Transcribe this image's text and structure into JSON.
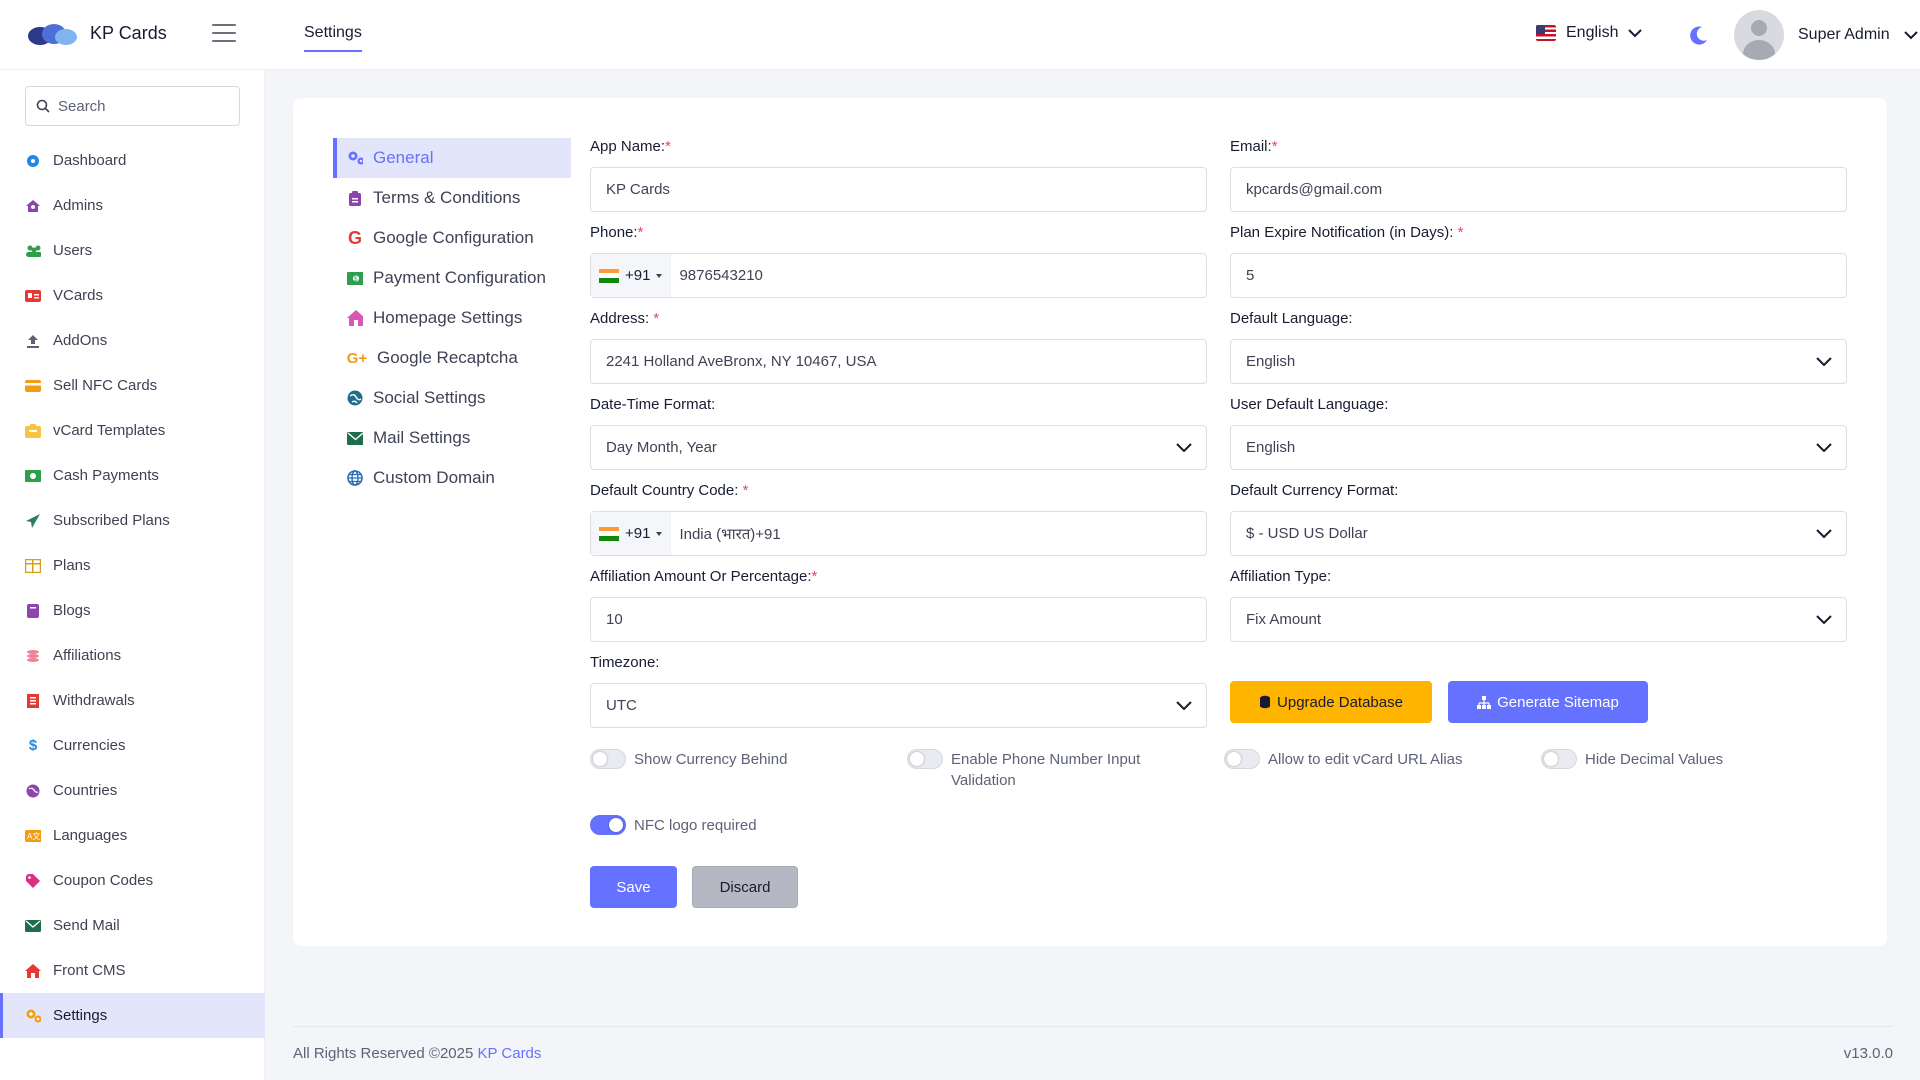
{
  "app": {
    "brand": "KP Cards"
  },
  "header": {
    "tab": "Settings",
    "language": "English",
    "user_name": "Super Admin"
  },
  "sidebar": {
    "search_placeholder": "Search",
    "items": [
      {
        "label": "Dashboard",
        "icon": "dashboard-icon"
      },
      {
        "label": "Admins",
        "icon": "admins-icon"
      },
      {
        "label": "Users",
        "icon": "users-icon"
      },
      {
        "label": "VCards",
        "icon": "vcard-icon"
      },
      {
        "label": "AddOns",
        "icon": "upload-icon"
      },
      {
        "label": "Sell NFC Cards",
        "icon": "card-icon"
      },
      {
        "label": "vCard Templates",
        "icon": "template-icon"
      },
      {
        "label": "Cash Payments",
        "icon": "cash-icon"
      },
      {
        "label": "Subscribed Plans",
        "icon": "paper-plane-icon"
      },
      {
        "label": "Plans",
        "icon": "plans-icon"
      },
      {
        "label": "Blogs",
        "icon": "book-icon"
      },
      {
        "label": "Affiliations",
        "icon": "coins-icon"
      },
      {
        "label": "Withdrawals",
        "icon": "receipt-icon"
      },
      {
        "label": "Currencies",
        "icon": "dollar-icon"
      },
      {
        "label": "Countries",
        "icon": "globe-icon"
      },
      {
        "label": "Languages",
        "icon": "language-icon"
      },
      {
        "label": "Coupon Codes",
        "icon": "tag-icon"
      },
      {
        "label": "Send Mail",
        "icon": "mail-icon"
      },
      {
        "label": "Front CMS",
        "icon": "home-icon"
      },
      {
        "label": "Settings",
        "icon": "gears-icon"
      }
    ]
  },
  "settings_nav": [
    {
      "label": "General",
      "icon": "gears-icon"
    },
    {
      "label": "Terms & Conditions",
      "icon": "clipboard-icon"
    },
    {
      "label": "Google Configuration",
      "icon": "google-icon"
    },
    {
      "label": "Payment Configuration",
      "icon": "money-icon"
    },
    {
      "label": "Homepage Settings",
      "icon": "home-icon"
    },
    {
      "label": "Google Recaptcha",
      "icon": "google-plus-icon"
    },
    {
      "label": "Social Settings",
      "icon": "globe-icon"
    },
    {
      "label": "Mail Settings",
      "icon": "mail-icon"
    },
    {
      "label": "Custom Domain",
      "icon": "globe-grid-icon"
    }
  ],
  "form": {
    "app_name": {
      "label": "App Name:",
      "value": "KP Cards"
    },
    "email": {
      "label": "Email:",
      "value": "kpcards@gmail.com"
    },
    "phone": {
      "label": "Phone:",
      "code": "+91",
      "value": "9876543210"
    },
    "plan_expire": {
      "label": "Plan Expire Notification (in Days): ",
      "value": "5"
    },
    "address": {
      "label": "Address: ",
      "value": "2241 Holland AveBronx, NY 10467, USA"
    },
    "default_language": {
      "label": "Default Language:",
      "value": "English"
    },
    "datetime_format": {
      "label": "Date-Time Format:",
      "value": "Day Month, Year"
    },
    "user_default_language": {
      "label": "User Default Language:",
      "value": "English"
    },
    "country_code": {
      "label": "Default Country Code: ",
      "code": "+91",
      "value": "India (भारत)+91"
    },
    "currency_format": {
      "label": "Default Currency Format:",
      "value": "$ - USD US Dollar"
    },
    "affiliation_amount": {
      "label": "Affiliation Amount Or Percentage:",
      "value": "10"
    },
    "affiliation_type": {
      "label": "Affiliation Type:",
      "value": "Fix Amount"
    },
    "timezone": {
      "label": "Timezone:",
      "value": "UTC"
    }
  },
  "buttons": {
    "upgrade_db": "Upgrade Database",
    "sitemap": "Generate Sitemap",
    "save": "Save",
    "discard": "Discard"
  },
  "toggles": [
    {
      "label": "Show Currency Behind",
      "on": false
    },
    {
      "label": "Enable Phone Number Input Validation",
      "on": false
    },
    {
      "label": "Allow to edit vCard URL Alias",
      "on": false
    },
    {
      "label": "Hide Decimal Values",
      "on": false
    },
    {
      "label": "NFC logo required",
      "on": true
    }
  ],
  "footer": {
    "copyright": "All Rights Reserved ©2025 ",
    "brand_link": "KP Cards",
    "version": "v13.0.0"
  },
  "colors": {
    "accent": "#6571ff",
    "warning": "#ffb400",
    "required": "#f1416c"
  }
}
